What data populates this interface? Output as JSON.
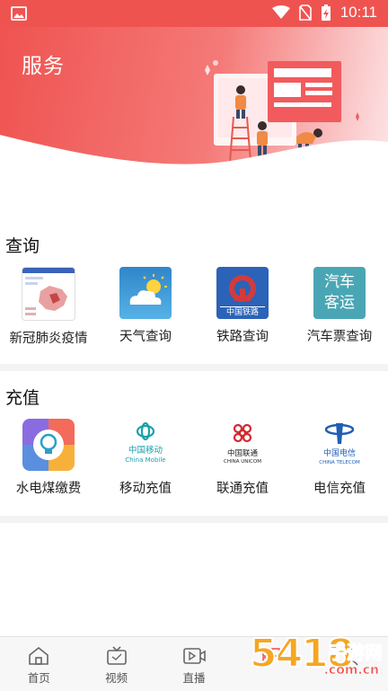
{
  "status_bar": {
    "time": "10:11"
  },
  "banner": {
    "title": "服务"
  },
  "sections": [
    {
      "title": "查询",
      "items": [
        {
          "label": "新冠肺炎疫情",
          "icon": "epidemic-map-icon"
        },
        {
          "label": "天气查询",
          "icon": "weather-cloud-sun-icon"
        },
        {
          "label": "铁路查询",
          "icon": "china-railway-icon",
          "logo_text": "中国铁路"
        },
        {
          "label": "汽车票查询",
          "icon": "bus-ticket-icon",
          "logo_text_1": "汽车",
          "logo_text_2": "客运"
        }
      ]
    },
    {
      "title": "充值",
      "items": [
        {
          "label": "水电煤缴费",
          "icon": "utilities-bulb-icon"
        },
        {
          "label": "移动充值",
          "icon": "china-mobile-logo-icon",
          "logo_text_1": "中国移动",
          "logo_text_2": "China Mobile"
        },
        {
          "label": "联通充值",
          "icon": "china-unicom-logo-icon",
          "logo_text_1": "中国联通",
          "logo_text_2": "CHINA UNICOM"
        },
        {
          "label": "电信充值",
          "icon": "china-telecom-logo-icon",
          "logo_text_1": "中国电信",
          "logo_text_2": "CHINA TELECOM"
        }
      ]
    }
  ],
  "tabbar": [
    {
      "label": "首页",
      "icon": "home-icon"
    },
    {
      "label": "视频",
      "icon": "tv-icon"
    },
    {
      "label": "直播",
      "icon": "live-video-icon"
    },
    {
      "label": "",
      "icon": "service-icon"
    },
    {
      "label": "",
      "icon": "profile-icon"
    }
  ],
  "watermark": {
    "text_1": "5418",
    "text_2": "手游网",
    "text_3": ".com.cn"
  },
  "colors": {
    "accent": "#ef5350",
    "mobile": "#18a0a8",
    "unicom": "#d2282e",
    "telecom": "#1f5fb4",
    "railway": "#2b63b8",
    "bus": "#4aa6b4"
  }
}
